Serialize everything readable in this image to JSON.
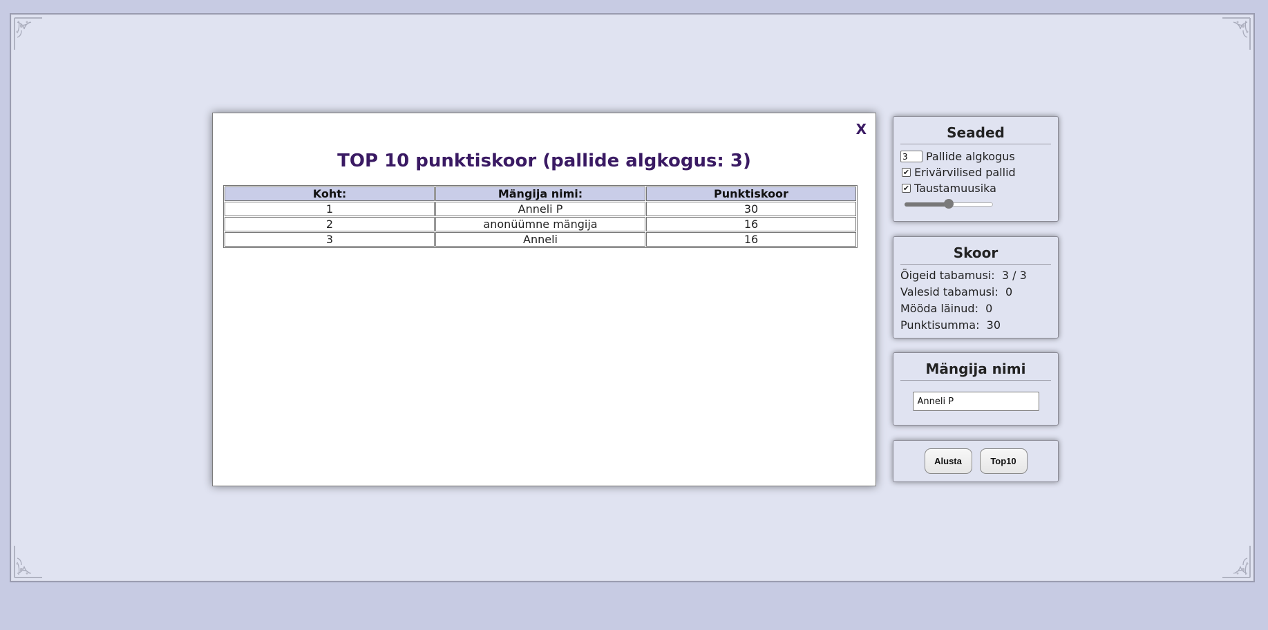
{
  "modal": {
    "close_label": "X",
    "title": "TOP 10 punktiskoor (pallide algkogus: 3)",
    "columns": [
      "Koht:",
      "Mängija nimi:",
      "Punktiskoor"
    ],
    "rows": [
      {
        "rank": "1",
        "name": "Anneli P",
        "score": "30"
      },
      {
        "rank": "2",
        "name": "anonüümne mängija",
        "score": "16"
      },
      {
        "rank": "3",
        "name": "Anneli",
        "score": "16"
      }
    ]
  },
  "settings": {
    "title": "Seaded",
    "ball_count_value": "3",
    "ball_count_label": "Pallide algkogus",
    "multicolor_label": "Erivärvilised pallid",
    "multicolor_checked": true,
    "music_label": "Taustamuusika",
    "music_checked": true,
    "volume_fraction": 0.5
  },
  "score": {
    "title": "Skoor",
    "correct_label": "Õigeid tabamusi:",
    "correct_value": "3 / 3",
    "wrong_label": "Valesid tabamusi:",
    "wrong_value": "0",
    "missed_label": "Mööda läinud:",
    "missed_value": "0",
    "total_label": "Punktisumma:",
    "total_value": "30"
  },
  "player": {
    "title": "Mängija nimi",
    "name_value": "Anneli P"
  },
  "buttons": {
    "start_label": "Alusta",
    "top10_label": "Top10"
  },
  "colors": {
    "title_purple": "#3a1a63",
    "page_bg": "#c7cbe3",
    "panel_bg": "#e0e3f1",
    "table_header_bg": "#c9cde8"
  }
}
